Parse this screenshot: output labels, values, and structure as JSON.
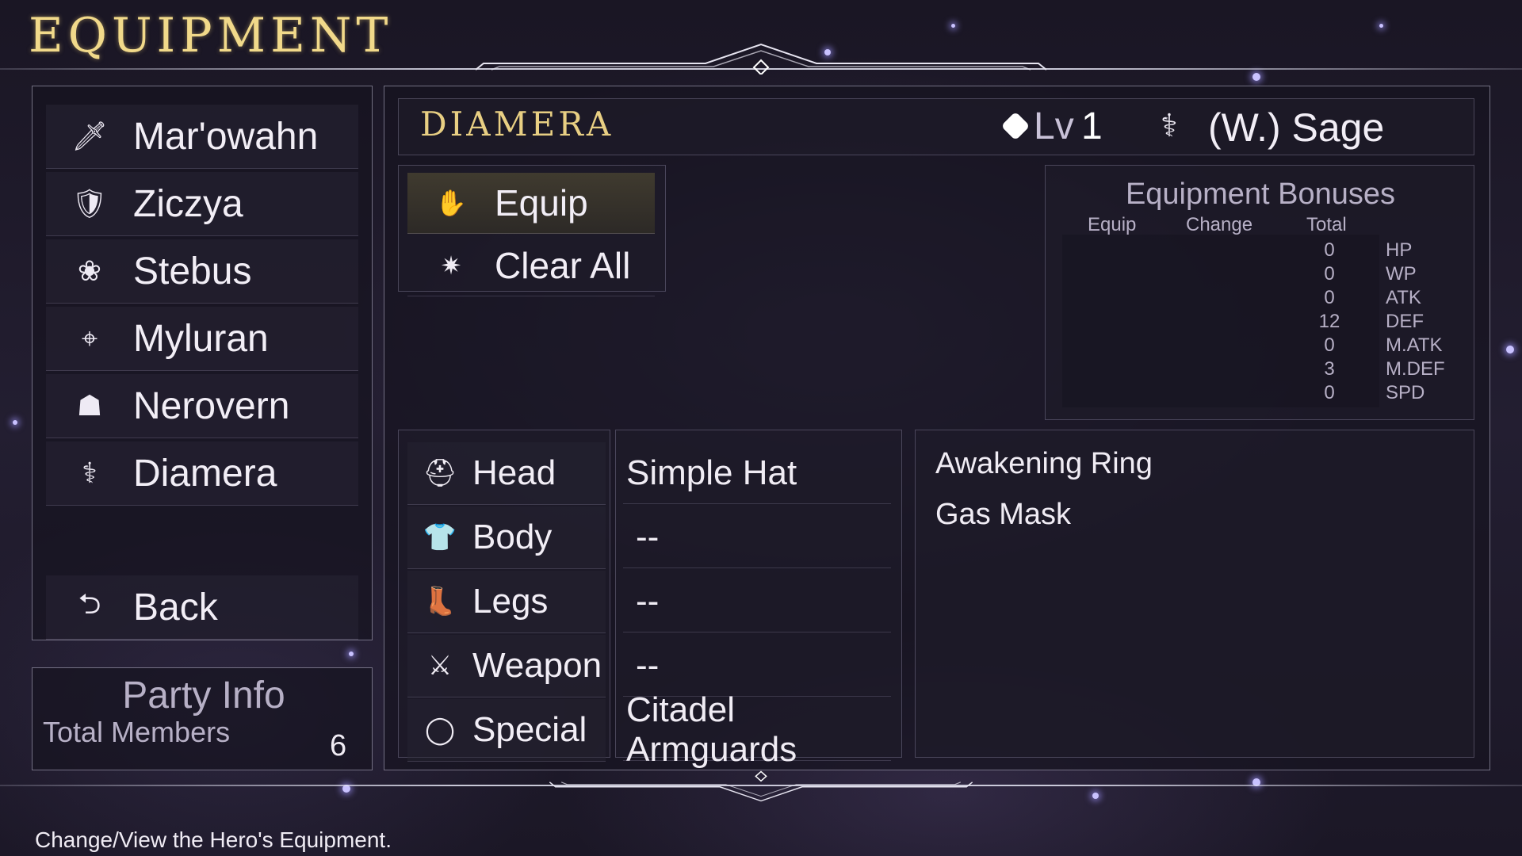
{
  "title": "EQUIPMENT",
  "roster": [
    {
      "name": "Mar'owahn",
      "icon": "sword-icon",
      "glyph": "🗡"
    },
    {
      "name": "Ziczya",
      "icon": "shield-icon",
      "glyph": "🛡"
    },
    {
      "name": "Stebus",
      "icon": "lotus-icon",
      "glyph": "❀"
    },
    {
      "name": "Myluran",
      "icon": "bow-icon",
      "glyph": "⌖"
    },
    {
      "name": "Nerovern",
      "icon": "hood-icon",
      "glyph": "☗"
    },
    {
      "name": "Diamera",
      "icon": "staff-icon",
      "glyph": "⚕"
    }
  ],
  "back": {
    "label": "Back",
    "glyph": "⮌"
  },
  "party": {
    "title": "Party Info",
    "label": "Total Members",
    "count": "6"
  },
  "character": {
    "name": "DIAMERA",
    "lv_label": "Lv",
    "lv_value": "1",
    "class_name": "(W.) Sage",
    "class_glyph": "⚕"
  },
  "commands": [
    {
      "label": "Equip",
      "icon": "glove-icon",
      "glyph": "✋",
      "selected": true
    },
    {
      "label": "Clear All",
      "icon": "sparkle-icon",
      "glyph": "✷",
      "selected": false
    }
  ],
  "bonuses": {
    "title": "Equipment Bonuses",
    "headers": {
      "equip": "Equip",
      "change": "Change",
      "total": "Total"
    },
    "rows": [
      {
        "stat": "HP",
        "total": "0"
      },
      {
        "stat": "WP",
        "total": "0"
      },
      {
        "stat": "ATK",
        "total": "0"
      },
      {
        "stat": "DEF",
        "total": "12"
      },
      {
        "stat": "M.ATK",
        "total": "0"
      },
      {
        "stat": "M.DEF",
        "total": "3"
      },
      {
        "stat": "SPD",
        "total": "0"
      }
    ]
  },
  "slots": [
    {
      "label": "Head",
      "value": "Simple Hat",
      "icon": "helmet-icon",
      "glyph": "⛑"
    },
    {
      "label": "Body",
      "value": "--",
      "icon": "armor-icon",
      "glyph": "👕"
    },
    {
      "label": "Legs",
      "value": "--",
      "icon": "boot-icon",
      "glyph": "👢"
    },
    {
      "label": "Weapon",
      "value": "--",
      "icon": "crossed-swords-icon",
      "glyph": "⚔"
    },
    {
      "label": "Special",
      "value": "Citadel Armguards",
      "icon": "ring-icon",
      "glyph": "◯"
    }
  ],
  "inventory": [
    "Awakening Ring",
    "Gas Mask"
  ],
  "help_text": "Change/View the Hero's Equipment."
}
